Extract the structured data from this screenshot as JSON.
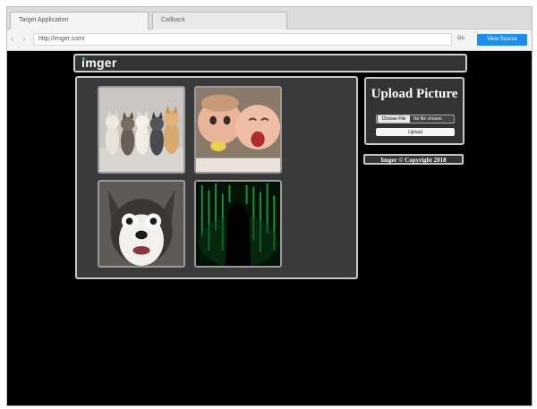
{
  "browser": {
    "tabs": [
      {
        "label": "Target Application",
        "active": true
      },
      {
        "label": "Callback",
        "active": false
      }
    ],
    "nav": {
      "back_icon": "chevron-left-icon",
      "forward_icon": "chevron-right-icon"
    },
    "url": "http://imger.com/",
    "go_label": "Go",
    "view_source_label": "View Source",
    "accent_color": "#1c8ef0"
  },
  "site": {
    "logo": "imger",
    "accent_color": "#28c8a0",
    "gallery": {
      "images": [
        {
          "name": "kittens-image"
        },
        {
          "name": "babies-image"
        },
        {
          "name": "husky-dog-image"
        },
        {
          "name": "hooded-hacker-image"
        }
      ]
    },
    "upload": {
      "title": "Upload Picture",
      "choose_file_label": "Choose File",
      "file_status": "No file chosen",
      "upload_label": "Upload"
    },
    "copyright": "Imger © Copyright 2018"
  }
}
